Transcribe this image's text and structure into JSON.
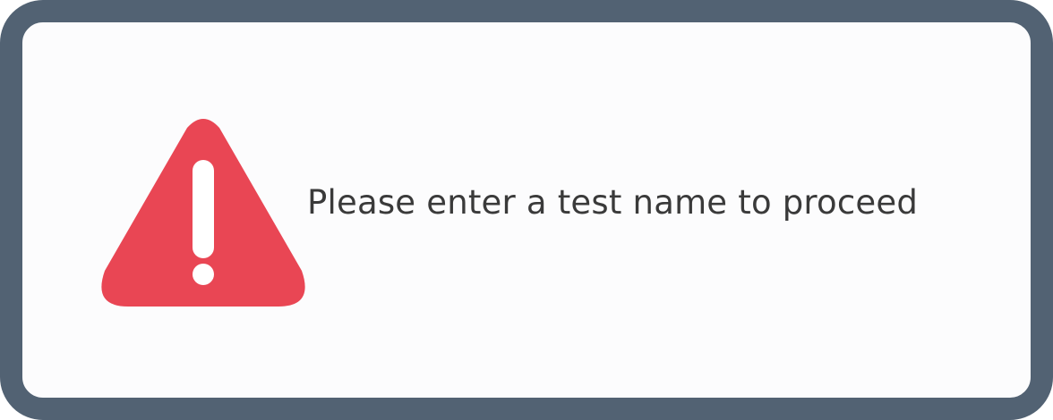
{
  "alert": {
    "icon": "warning-triangle-icon",
    "message": "Please enter a test name to proceed"
  },
  "colors": {
    "frame_border": "#526273",
    "panel_background": "#fcfcfd",
    "icon_red": "#e94654",
    "text": "#3a3a3a"
  }
}
